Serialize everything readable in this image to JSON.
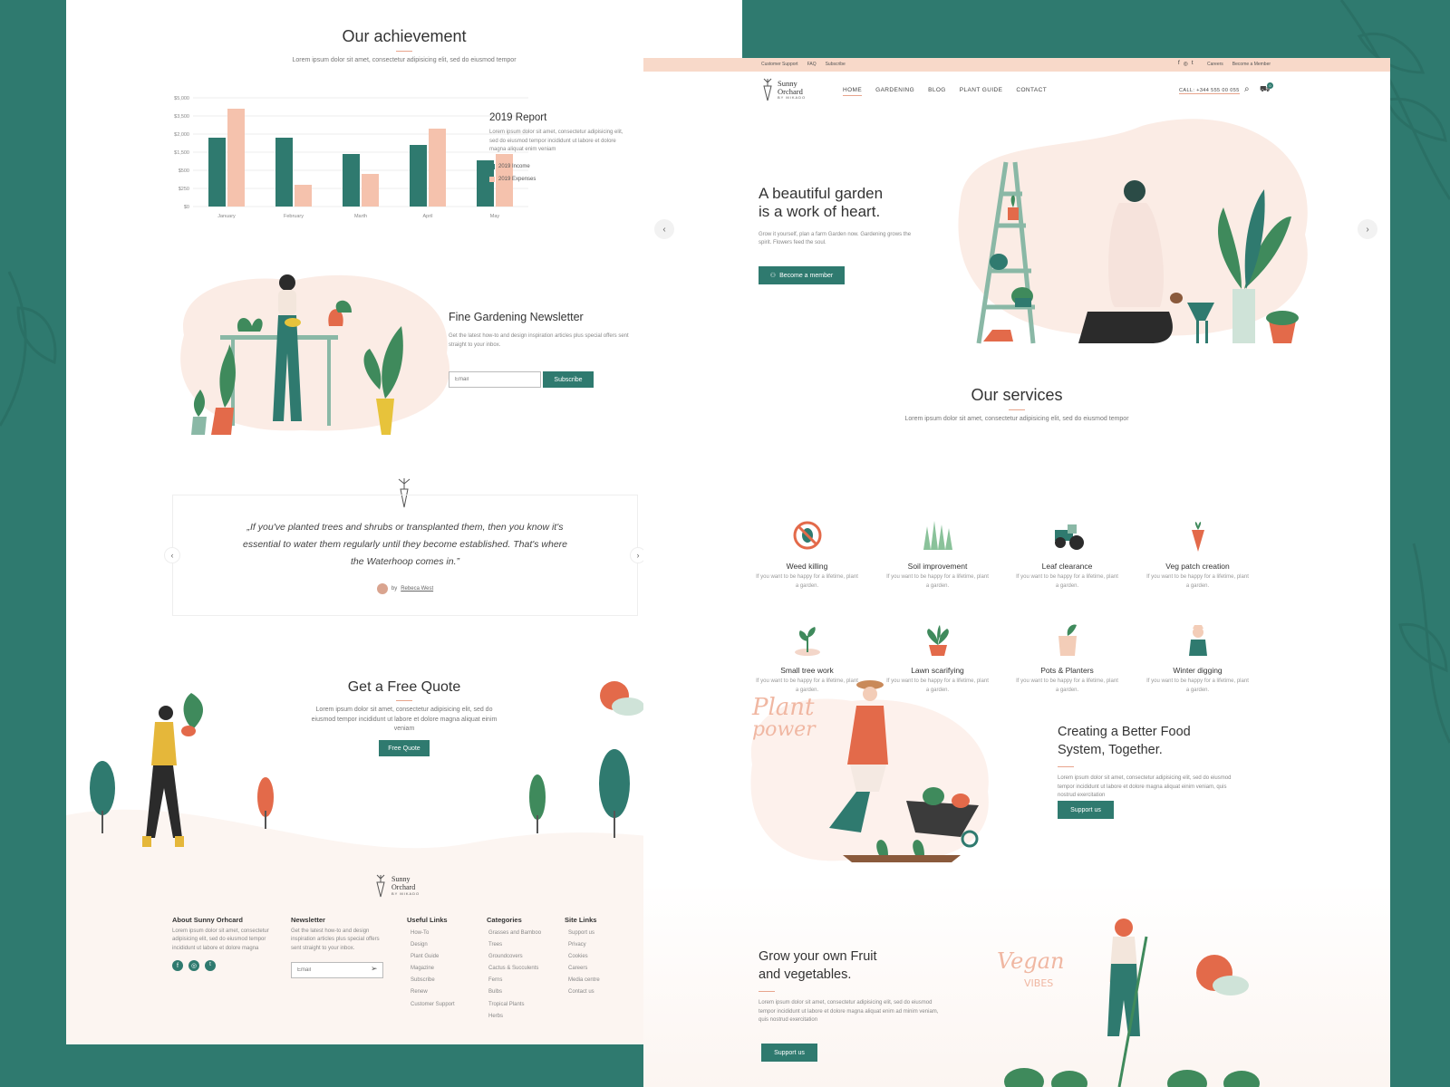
{
  "colors": {
    "teal": "#2f7a6f",
    "peach": "#f5c2ad",
    "orange": "#e36a4a",
    "topbar": "#f8d9c9"
  },
  "left": {
    "achievement": {
      "title": "Our achievement",
      "subtitle": "Lorem ipsum dolor sit amet, consectetur adipisicing elit, sed do eiusmod tempor"
    },
    "report": {
      "title": "2019 Report",
      "text": "Lorem ipsum dolor sit amet, consectetur adipisicing elit, sed do eiusmod tempor incididunt ut labore et dolore magna aliquat enim veniam",
      "legend_income": "2019 Income",
      "legend_expenses": "2019 Expenses"
    },
    "newsletter": {
      "title": "Fine Gardening Newsletter",
      "text": "Get the latest how-to and design inspiration articles plus special offers sent straight to your inbox.",
      "email_placeholder": "Email",
      "button": "Subscribe"
    },
    "testimonial": {
      "quote": "„If you've planted trees and shrubs or transplanted them, then you know it's essential to water them regularly until they become established. That's where the Waterhoop comes in.”",
      "by": "by",
      "author": "Rebeca West"
    },
    "quote": {
      "title": "Get a Free Quote",
      "text": "Lorem ipsum dolor sit amet, consectetur adipisicing elit, sed do eiusmod tempor incididunt ut labore et dolore magna aliquat einim veniam",
      "button": "Free Quote"
    },
    "footer": {
      "logo": "Sunny Orchard",
      "logo_sub": "BY MIKADO",
      "about_title": "About Sunny Orhcard",
      "about_text": "Lorem ipsum dolor sit amet, consectetur adipisicing elit, sed do eiusmod tempor incididunt ut labore et dolore magna",
      "newsletter_title": "Newsletter",
      "newsletter_text": "Get the latest how-to and design inspiration articles plus special offers sent straight to your inbox.",
      "email_placeholder": "Email",
      "useful_title": "Useful Links",
      "useful": [
        "How-To",
        "Design",
        "Plant Guide",
        "Magazine",
        "Subscribe",
        "Renew",
        "Customer Support"
      ],
      "categories_title": "Categories",
      "categories": [
        "Grasses and Bamboo",
        "Trees",
        "Groundcovers",
        "Cactus & Succulents",
        "Ferns",
        "Bulbs",
        "Tropical Plants",
        "Herbs"
      ],
      "site_title": "Site Links",
      "site": [
        "Support us",
        "Privacy",
        "Cookies",
        "Careers",
        "Media centre",
        "Contact us"
      ]
    }
  },
  "chart_data": {
    "type": "bar",
    "categories": [
      "January",
      "February",
      "Marth",
      "April",
      "May"
    ],
    "series": [
      {
        "name": "2019 Income",
        "values": [
          1900,
          1900,
          1400,
          1700,
          1050
        ]
      },
      {
        "name": "2019 Expenses",
        "values": [
          4100,
          300,
          450,
          2450,
          1400
        ]
      }
    ],
    "yticks": [
      "$5,000",
      "$3,500",
      "$2,000",
      "$1,500",
      "$500",
      "$250",
      "$0"
    ],
    "ylim": [
      0,
      5000
    ],
    "legend": "right",
    "grid": true
  },
  "right": {
    "topbar": {
      "links": [
        "Customer Support",
        "FAQ",
        "Subscribe"
      ],
      "right_links": [
        "Careers",
        "Become a Member"
      ]
    },
    "header": {
      "logo": "Sunny Orchard",
      "logo_sub": "BY MIKADO",
      "nav": [
        "HOME",
        "GARDENING",
        "BLOG",
        "PLANT GUIDE",
        "CONTACT"
      ],
      "call": "CALL: +344 555 00 055",
      "cart_count": "0"
    },
    "hero": {
      "title_line1": "A beautiful garden",
      "title_line2": "is a work of heart.",
      "text": "Grow it yourself, plan a farm Garden now. Gardening grows the spirit. Flowers feed the soul.",
      "button": "Become a member"
    },
    "services": {
      "title": "Our services",
      "subtitle": "Lorem ipsum dolor sit amet, consectetur adipisicing elit, sed do eiusmod tempor",
      "items": [
        {
          "title": "Weed killing",
          "desc": "If you want to be happy for a lifetime, plant a garden.",
          "icon": "no-bug-icon"
        },
        {
          "title": "Soil improvement",
          "desc": "If you want to be happy for a lifetime, plant a garden.",
          "icon": "grass-icon"
        },
        {
          "title": "Leaf clearance",
          "desc": "If you want to be happy for a lifetime, plant a garden.",
          "icon": "tractor-icon"
        },
        {
          "title": "Veg patch creation",
          "desc": "If you want to be happy for a lifetime, plant a garden.",
          "icon": "carrot-icon"
        },
        {
          "title": "Small tree work",
          "desc": "If you want to be happy for a lifetime, plant a garden.",
          "icon": "sprout-icon"
        },
        {
          "title": "Lawn scarifying",
          "desc": "If you want to be happy for a lifetime, plant a garden.",
          "icon": "potted-plant-icon"
        },
        {
          "title": "Pots & Planters",
          "desc": "If you want to be happy for a lifetime, plant a garden.",
          "icon": "planter-bag-icon"
        },
        {
          "title": "Winter digging",
          "desc": "If you want to be happy for a lifetime, plant a garden.",
          "icon": "gardener-icon"
        }
      ]
    },
    "food": {
      "title_line1": "Creating a Better Food",
      "title_line2": "System, Together.",
      "text": "Lorem ipsum dolor sit amet, consectetur adipisicing elit, sed do eiusmod tempor incididunt ut labore et dolore magna aliquat einim veniam, quis nostrud exercitation",
      "button": "Support us",
      "script_line1": "Plant",
      "script_line2": "power"
    },
    "fruit": {
      "title_line1": "Grow your own Fruit",
      "title_line2": "and vegetables.",
      "text": "Lorem ipsum dolor sit amet, consectetur adipisicing elit, sed do eiusmod tempor incididunt ut labore et dolore magna aliquat enim ad minim veniam, quis nostrud exercitation",
      "button": "Support us",
      "script_line1": "Vegan",
      "script_line2": "VIBES"
    }
  }
}
